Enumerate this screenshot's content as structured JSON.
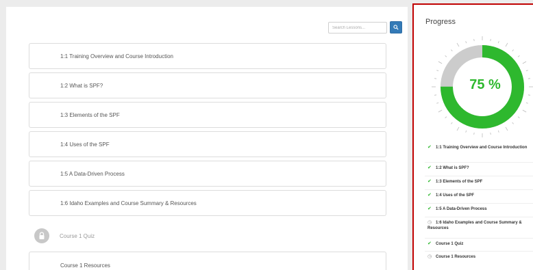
{
  "search": {
    "placeholder": "Search Lessons..."
  },
  "lessons": [
    {
      "label": "1:1 Training Overview and Course Introduction"
    },
    {
      "label": "1:2 What is SPF?"
    },
    {
      "label": "1:3 Elements of the SPF"
    },
    {
      "label": "1:4 Uses of the SPF"
    },
    {
      "label": "1:5 A Data-Driven Process"
    },
    {
      "label": "1:6 Idaho Examples and Course Summary & Resources"
    }
  ],
  "quiz": {
    "label": "Course 1 Quiz",
    "icon": "lock-icon"
  },
  "resources": {
    "label": "Course 1 Resources"
  },
  "progress": {
    "title": "Progress",
    "percent_text": "75 %",
    "percent": 75,
    "colors": {
      "complete": "#2eb82e",
      "remaining": "#cccccc",
      "accent_border": "#c00000",
      "button": "#337ab7"
    },
    "items": [
      {
        "label": "1:1 Training Overview and Course Introduction",
        "status": "complete",
        "icon": "check-icon"
      },
      {
        "label": "1:2 What is SPF?",
        "status": "complete",
        "icon": "check-icon"
      },
      {
        "label": "1:3 Elements of the SPF",
        "status": "complete",
        "icon": "check-icon"
      },
      {
        "label": "1:4 Uses of the SPF",
        "status": "complete",
        "icon": "check-icon"
      },
      {
        "label": "1:5 A Data-Driven Process",
        "status": "complete",
        "icon": "check-icon"
      },
      {
        "label": "1:6 Idaho Examples and Course Summary & Resources",
        "status": "pending",
        "icon": "clock-icon"
      },
      {
        "label": "Course 1 Quiz",
        "status": "complete",
        "icon": "check-icon"
      },
      {
        "label": "Course 1 Resources",
        "status": "pending",
        "icon": "clock-icon"
      }
    ]
  }
}
